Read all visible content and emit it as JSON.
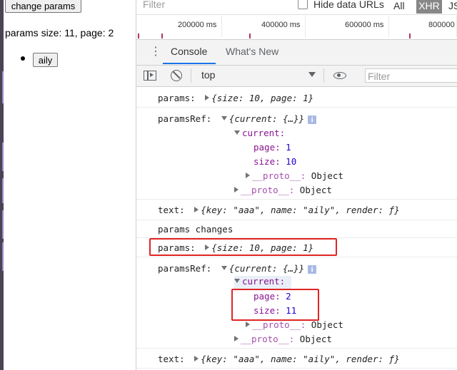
{
  "page": {
    "change_button": "change params",
    "params_text": "params size: 11, page: 2",
    "list_button": "aily"
  },
  "devtools": {
    "filter_placeholder": "Filter",
    "hide_data_urls": "Hide data URLs",
    "type_filters": {
      "all": "All",
      "xhr": "XHR",
      "js": "JS"
    },
    "timeline_ticks": [
      "200000 ms",
      "400000 ms",
      "600000 ms",
      "800000"
    ],
    "tabs": {
      "console": "Console",
      "whats_new": "What's New"
    },
    "context": "top",
    "console_filter_placeholder": "Filter"
  },
  "console": {
    "r1": {
      "label": "params:",
      "value": "{size: 10, page: 1}"
    },
    "r2": {
      "label": "paramsRef:",
      "value": "{current: {…}}"
    },
    "r2_current": "current:",
    "r2_page": {
      "key": "page:",
      "val": "1"
    },
    "r2_size": {
      "key": "size:",
      "val": "10"
    },
    "r2_proto_inner": {
      "key": "__proto__:",
      "val": "Object"
    },
    "r2_proto_outer": {
      "key": "__proto__:",
      "val": "Object"
    },
    "r3": {
      "label": "text:",
      "value": "{key: \"aaa\", name: \"aily\", render: ƒ}"
    },
    "r4": "params changes",
    "r5": {
      "label": "params:",
      "value": "{size: 10, page: 1}"
    },
    "r6": {
      "label": "paramsRef:",
      "value": "{current: {…}}"
    },
    "r6_current": "current:",
    "r6_page": {
      "key": "page:",
      "val": "2"
    },
    "r6_size": {
      "key": "size:",
      "val": "11"
    },
    "r6_proto_inner": {
      "key": "__proto__:",
      "val": "Object"
    },
    "r6_proto_outer": {
      "key": "__proto__:",
      "val": "Object"
    },
    "r7": {
      "label": "text:",
      "value": "{key: \"aaa\", name: \"aily\", render: ƒ}"
    }
  },
  "colors": {
    "accent": "#1a73e8",
    "highlight_box": "#e02424",
    "xhr_bg": "#878787"
  }
}
